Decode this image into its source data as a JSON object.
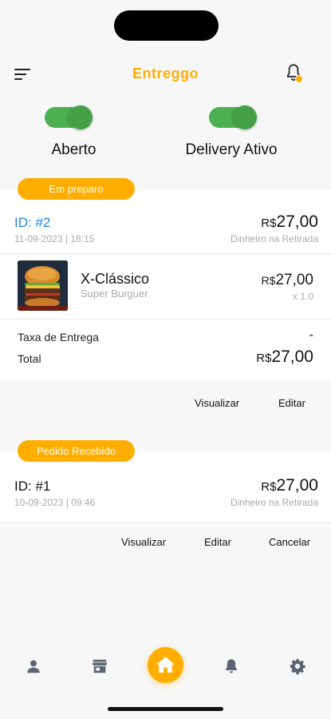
{
  "app": {
    "title": "Entreggo"
  },
  "toggles": [
    {
      "label": "Aberto",
      "on": true
    },
    {
      "label": "Delivery Ativo",
      "on": true
    }
  ],
  "colors": {
    "accent": "#ffae00",
    "toggle_on": "#4caf50",
    "id_blue": "#1e88e5"
  },
  "orders": [
    {
      "status": "Em preparo",
      "id": "ID: #2",
      "datetime": "11-09-2023 | 18:15",
      "currency": "R$",
      "amount": "27,00",
      "payment": "Dinheiro na Retirada",
      "item": {
        "name": "X-Clássico",
        "store": "Super Burguer",
        "currency": "R$",
        "amount": "27,00",
        "qty": "x 1.0"
      },
      "delivery_fee_label": "Taxa de Entrega",
      "delivery_fee_value": "-",
      "total_label": "Total",
      "total_currency": "R$",
      "total_amount": "27,00",
      "actions": [
        "Visualizar",
        "Editar"
      ]
    },
    {
      "status": "Pedido Recebido",
      "id": "ID: #1",
      "datetime": "10-09-2023 | 09:46",
      "currency": "R$",
      "amount": "27,00",
      "payment": "Dinheiro na Retirada",
      "actions": [
        "Visualizar",
        "Editar",
        "Cancelar"
      ]
    }
  ],
  "tabbar": [
    "user-icon",
    "store-icon",
    "home-icon",
    "bell-icon",
    "gear-icon"
  ]
}
